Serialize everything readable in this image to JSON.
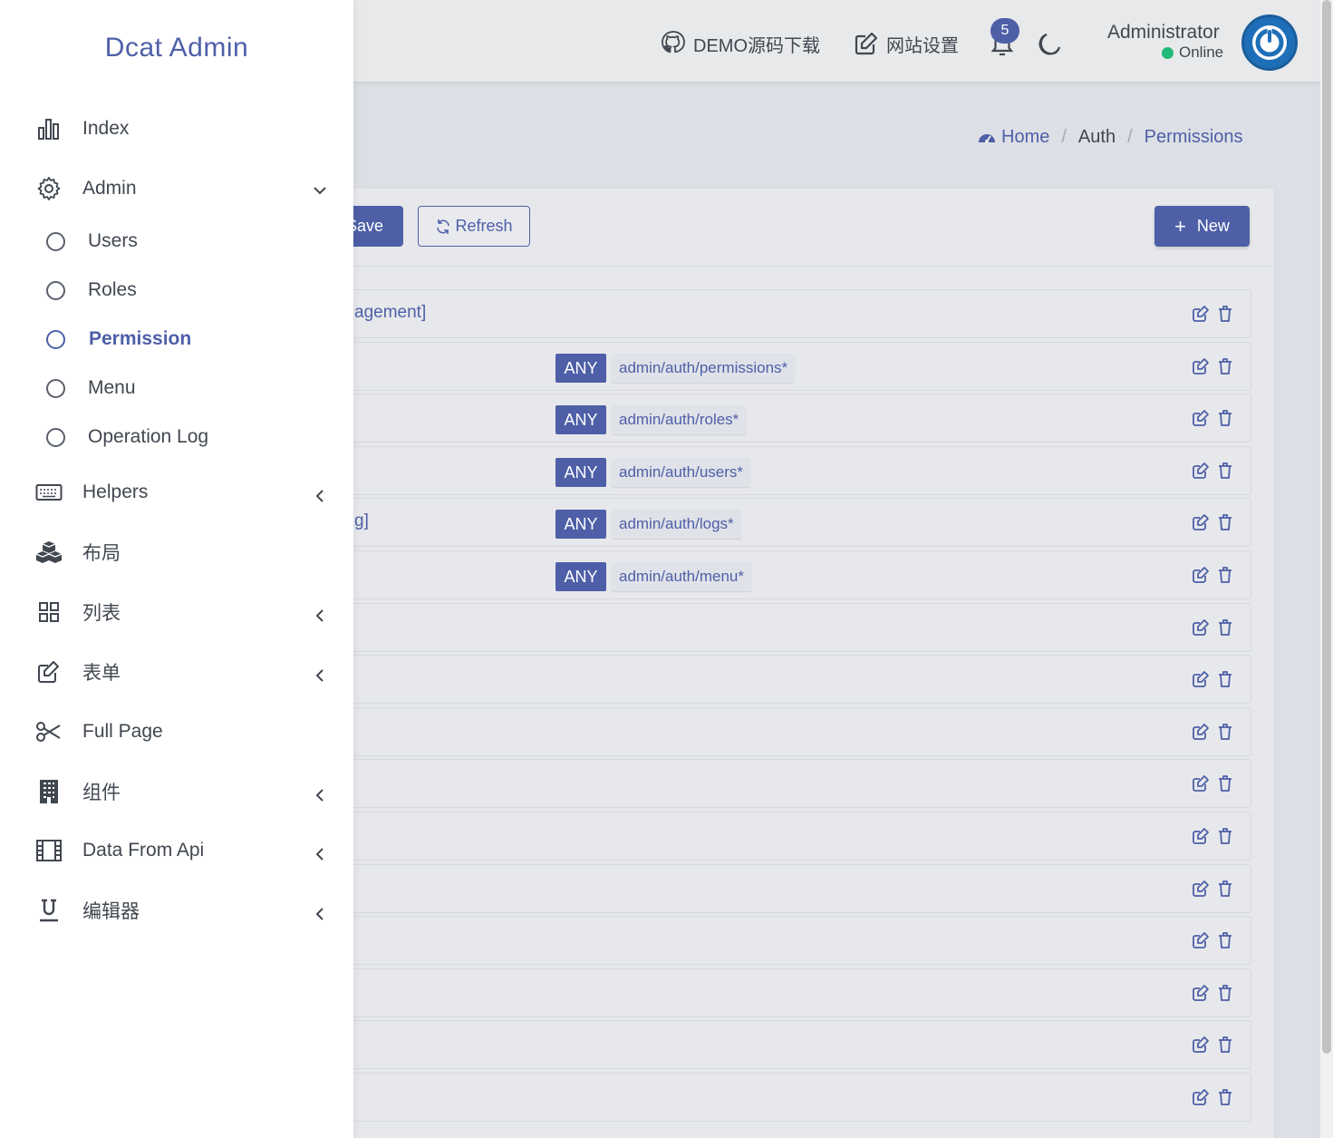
{
  "brand": "Dcat Admin",
  "navbar": {
    "github_label": "DEMO源码下载",
    "settings_label": "网站设置",
    "notification_count": "5",
    "user_name": "Administrator",
    "user_status": "Online"
  },
  "breadcrumb": {
    "home": "Home",
    "sep1": "/",
    "auth": "Auth",
    "sep2": "/",
    "current": "Permissions"
  },
  "toolbar": {
    "save": "Save",
    "refresh": "Refresh",
    "new": "New"
  },
  "sidebar": {
    "items": [
      {
        "label": "Index",
        "icon": "bar-chart-icon"
      },
      {
        "label": "Admin",
        "icon": "gear-icon",
        "arrow": "down"
      },
      {
        "label": "Helpers",
        "icon": "keyboard-icon",
        "arrow": "left"
      },
      {
        "label": "布局",
        "icon": "cubes-icon"
      },
      {
        "label": "列表",
        "icon": "grid-icon",
        "arrow": "left"
      },
      {
        "label": "表单",
        "icon": "edit-icon",
        "arrow": "left"
      },
      {
        "label": "Full Page",
        "icon": "scissors-icon"
      },
      {
        "label": "组件",
        "icon": "building-icon",
        "arrow": "left"
      },
      {
        "label": "Data From Api",
        "icon": "film-icon",
        "arrow": "left"
      },
      {
        "label": "编辑器",
        "icon": "underline-icon",
        "arrow": "left"
      }
    ],
    "admin_sub": [
      {
        "label": "Users"
      },
      {
        "label": "Roles"
      },
      {
        "label": "Permission",
        "active": true
      },
      {
        "label": "Menu"
      },
      {
        "label": "Operation Log"
      }
    ]
  },
  "rows": [
    {
      "title": "agement]",
      "method": "",
      "path": ""
    },
    {
      "title": "",
      "method": "ANY",
      "path": "admin/auth/permissions*"
    },
    {
      "title": "",
      "method": "ANY",
      "path": "admin/auth/roles*"
    },
    {
      "title": "",
      "method": "ANY",
      "path": "admin/auth/users*"
    },
    {
      "title": "g]",
      "method": "ANY",
      "path": "admin/auth/logs*"
    },
    {
      "title": "",
      "method": "ANY",
      "path": "admin/auth/menu*"
    },
    {
      "title": "",
      "method": "",
      "path": ""
    },
    {
      "title": "",
      "method": "",
      "path": ""
    },
    {
      "title": "",
      "method": "",
      "path": ""
    },
    {
      "title": "",
      "method": "",
      "path": ""
    },
    {
      "title": "",
      "method": "",
      "path": ""
    },
    {
      "title": "",
      "method": "",
      "path": ""
    },
    {
      "title": "",
      "method": "",
      "path": ""
    },
    {
      "title": "",
      "method": "",
      "path": ""
    },
    {
      "title": "",
      "method": "",
      "path": ""
    },
    {
      "title": "",
      "method": "",
      "path": ""
    }
  ],
  "colors": {
    "primary": "#4e5fa8",
    "online": "#21b978",
    "avatar": "#1e6fb8"
  }
}
